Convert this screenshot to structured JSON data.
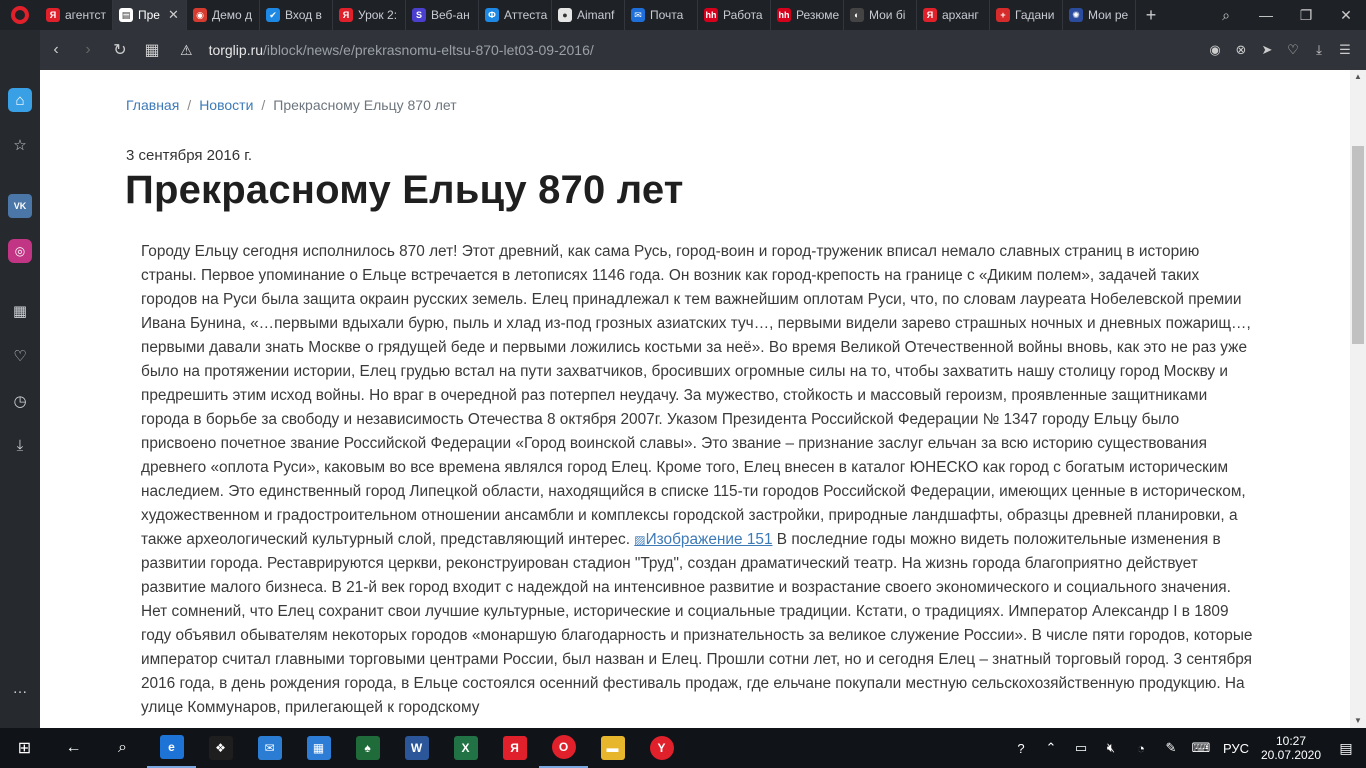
{
  "browser": {
    "tabs": [
      {
        "label": "агентст",
        "fav_color": "#e0202a",
        "fav_text": "Я"
      },
      {
        "label": "Пре",
        "fav_color": "#ffffff",
        "fav_text": "▤",
        "active": true
      },
      {
        "label": "Демо д",
        "fav_color": "#d63b2f",
        "fav_text": "◉"
      },
      {
        "label": "Вход в",
        "fav_color": "#1e88e5",
        "fav_text": "✔"
      },
      {
        "label": "Урок 2:",
        "fav_color": "#e0202a",
        "fav_text": "Я"
      },
      {
        "label": "Веб-ан",
        "fav_color": "#4b3fcf",
        "fav_text": "S"
      },
      {
        "label": "Аттеста",
        "fav_color": "#1e88e5",
        "fav_text": "Ф"
      },
      {
        "label": "Aimanf",
        "fav_color": "#e5e5e5",
        "fav_text": "●"
      },
      {
        "label": "Почта",
        "fav_color": "#1e6fd9",
        "fav_text": "✉"
      },
      {
        "label": "Работа",
        "fav_color": "#d6001c",
        "fav_text": "hh"
      },
      {
        "label": "Резюме",
        "fav_color": "#d6001c",
        "fav_text": "hh"
      },
      {
        "label": "Мои бі",
        "fav_color": "#444444",
        "fav_text": "◐"
      },
      {
        "label": "арханг",
        "fav_color": "#e0202a",
        "fav_text": "Я"
      },
      {
        "label": "Гадани",
        "fav_color": "#d62b2b",
        "fav_text": "+"
      },
      {
        "label": "Мои ре",
        "fav_color": "#2b4b9c",
        "fav_text": "✺"
      }
    ],
    "url_host": "torglip.ru",
    "url_path": "/iblock/news/e/prekrasnomu-eltsu-870-let03-09-2016/"
  },
  "page": {
    "breadcrumb": {
      "home": "Главная",
      "news": "Новости",
      "current": "Прекрасному Ельцу 870 лет",
      "separator": "/"
    },
    "date": "3 сентября 2016 г.",
    "title": "Прекрасному Ельцу 870 лет",
    "article_part1": "Городу Ельцу сегодня исполнилось 870 лет! Этот древний, как сама Русь, город-воин и город-труженик вписал немало славных страниц в историю страны. Первое упоминание о Ельце встречается в летописях 1146 года. Он возник как город-крепость на границе с «Диким полем», задачей таких городов на Руси была защита окраин русских земель. Елец принадлежал к тем важнейшим оплотам Руси, что, по словам лауреата Нобелевской премии Ивана Бунина, «…первыми вдыхали бурю, пыль и хлад из-под грозных азиатских туч…, первыми видели зарево страшных ночных и дневных пожарищ…, первыми давали знать Москве о грядущей беде и первыми ложились костьми за неё». Во время Великой Отечественной войны вновь, как это не раз уже было на протяжении истории, Елец грудью встал на пути захватчиков, бросивших огромные силы на то, чтобы захватить нашу столицу город Москву и предрешить этим исход войны. Но враг в очередной раз потерпел неудачу. За мужество, стойкость и массовый героизм, проявленные защитниками города в борьбе за свободу и независимость Отечества 8 октября 2007г. Указом Президента Российской Федерации № 1347 городу Ельцу было присвоено почетное звание Российской Федерации «Город воинской славы». Это звание – признание заслуг ельчан за всю историю существования древнего «оплота Руси», каковым во все времена являлся город Елец. Кроме того, Елец внесен в каталог ЮНЕСКО как город с богатым историческим наследием. Это единственный город Липецкой области, находящийся в списке 115-ти городов Российской Федерации, имеющих ценные в историческом, художественном и градостроительном отношении ансамбли и комплексы городской застройки, природные ландшафты, образцы древней планировки, а также археологический культурный слой, представляющий интерес.",
    "image_alt": "Изображение 151",
    "article_part2": "В последние годы можно видеть положительные изменения в развитии города. Реставрируются церкви, реконструирован стадион \"Труд\", создан драматический театр. На жизнь города благоприятно действует развитие малого бизнеса. В 21-й век город входит с надеждой на интенсивное развитие и возрастание своего экономического и социального значения. Нет сомнений, что Елец сохранит свои лучшие культурные, исторические и социальные традиции. Кстати, о традициях. Император Александр I в 1809 году объявил обывателям некоторых городов «монаршую благодарность и признательность за великое служение России». В числе пяти городов, которые император считал главными торговыми центрами России, был назван и Елец. Прошли сотни лет, но и сегодня Елец – знатный торговый город. 3 сентября 2016 года, в день рождения города, в Ельце состоялся осенний фестиваль продаж, где ельчане покупали местную сельскохозяйственную продукцию. На улице Коммунаров, прилегающей к городскому"
  },
  "taskbar": {
    "apps": [
      {
        "name": "edge",
        "color": "#1e73d6",
        "text": "e"
      },
      {
        "name": "dropbox",
        "color": "#1e1e1e",
        "text": "❖"
      },
      {
        "name": "mail",
        "color": "#2b7cd3",
        "text": "✉"
      },
      {
        "name": "calculator",
        "color": "#2d7cd6",
        "text": "▦"
      },
      {
        "name": "solitaire",
        "color": "#1f6b3a",
        "text": "♠"
      },
      {
        "name": "word",
        "color": "#2b579a",
        "text": "W"
      },
      {
        "name": "excel",
        "color": "#217346",
        "text": "X"
      },
      {
        "name": "yandex-browser",
        "color": "#e0202a",
        "text": "Я"
      },
      {
        "name": "opera",
        "color": "#e0202a",
        "text": "O"
      },
      {
        "name": "explorer",
        "color": "#e8b62c",
        "text": "▬"
      },
      {
        "name": "yandex",
        "color": "#e0202a",
        "text": "Y"
      }
    ],
    "lang": "РУС",
    "time": "10:27",
    "date": "20.07.2020"
  },
  "colors": {
    "link": "#3d7ab8",
    "browser_dark": "#1e2126"
  }
}
